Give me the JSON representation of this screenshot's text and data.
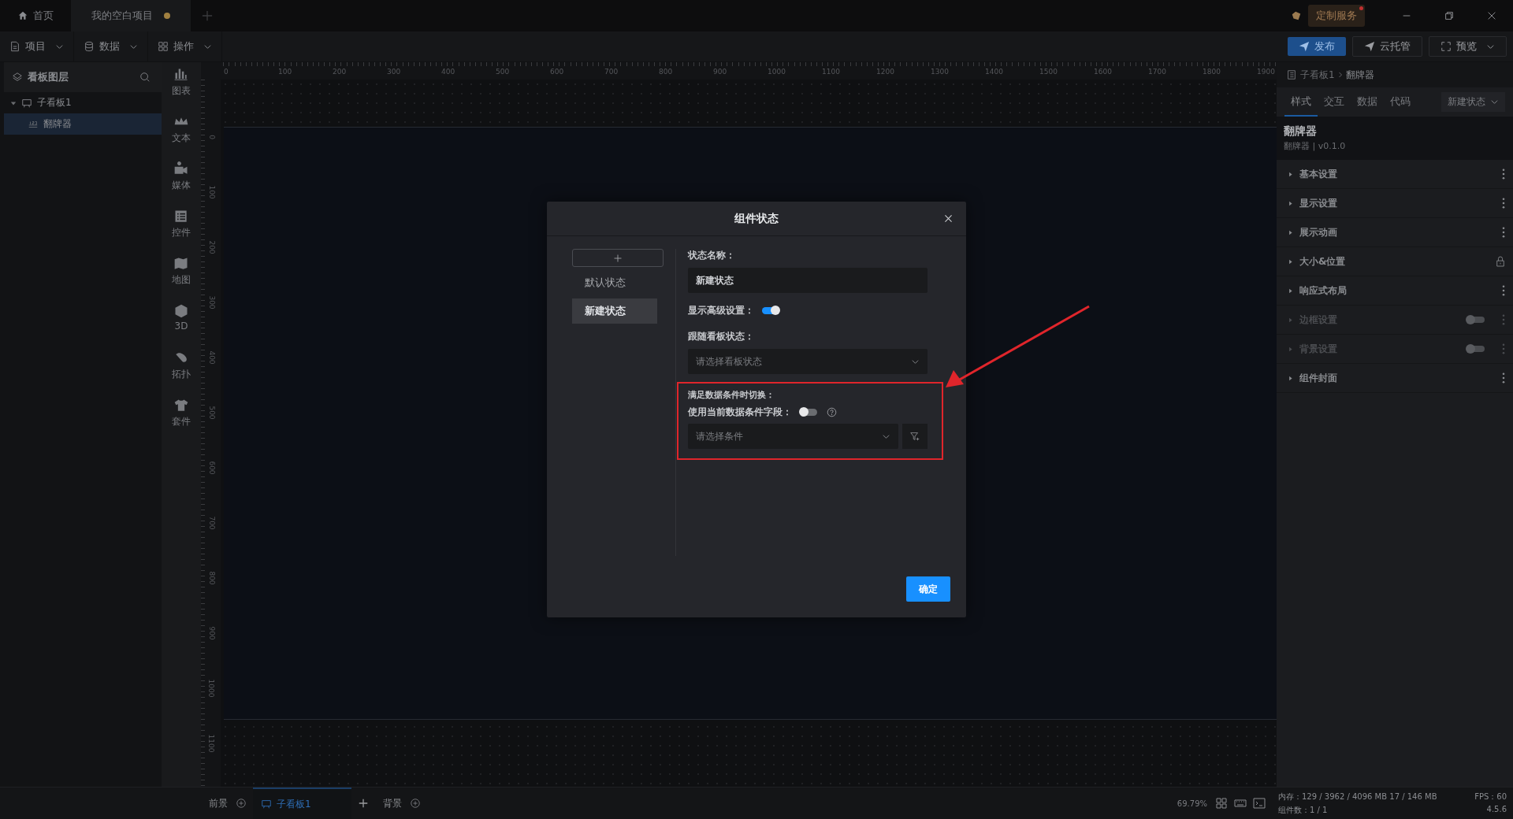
{
  "title_bar": {
    "tabs": [
      {
        "label": "首页",
        "kind": "home",
        "selected": false,
        "unsaved": false
      },
      {
        "label": "我的空白项目",
        "kind": "project",
        "selected": true,
        "unsaved": true
      }
    ],
    "service": "定制服务",
    "service_badge": true
  },
  "toolbar": {
    "menus": [
      "项目",
      "数据",
      "操作"
    ],
    "publish": "发布",
    "cloud": "云托管",
    "preview": "预览"
  },
  "layers": {
    "title": "看板图层",
    "tree": [
      {
        "label": "子看板1",
        "expanded": true,
        "selected": false,
        "children": [
          {
            "label": "翻牌器",
            "selected": true
          }
        ]
      }
    ]
  },
  "component_bar": [
    "图表",
    "文本",
    "媒体",
    "控件",
    "地图",
    "3D",
    "拓扑",
    "套件"
  ],
  "ruler": {
    "x_labels": [
      "0",
      "100",
      "200",
      "300",
      "400",
      "500",
      "600",
      "700",
      "800",
      "900",
      "1000",
      "1100",
      "1200",
      "1300",
      "1400",
      "1500",
      "1600",
      "1700",
      "1800",
      "1900"
    ],
    "y_labels": [
      "0",
      "100",
      "200",
      "300",
      "400",
      "500",
      "600",
      "700",
      "800",
      "900",
      "1000",
      "1100"
    ]
  },
  "dialog": {
    "title": "组件状态",
    "states": [
      {
        "label": "默认状态",
        "selected": false
      },
      {
        "label": "新建状态",
        "selected": true
      }
    ],
    "name_label": "状态名称：",
    "name_value": "新建状态",
    "advanced_label": "显示高级设置：",
    "advanced_on": true,
    "follow_label": "跟随看板状态：",
    "follow_placeholder": "请选择看板状态",
    "condition_title": "满足数据条件时切换：",
    "use_field_label": "使用当前数据条件字段：",
    "use_field_on": false,
    "condition_placeholder": "请选择条件",
    "confirm": "确定"
  },
  "inspector": {
    "breadcrumb": [
      "子看板1",
      "翻牌器"
    ],
    "tabs": [
      {
        "label": "样式",
        "selected": true
      },
      {
        "label": "交互",
        "selected": false
      },
      {
        "label": "数据",
        "selected": false
      },
      {
        "label": "代码",
        "selected": false
      }
    ],
    "state_select": "新建状态",
    "component_name": "翻牌器",
    "component_meta": "翻牌器 | v0.1.0",
    "sections": [
      {
        "label": "基本设置",
        "kind": "menu",
        "disabled": false
      },
      {
        "label": "显示设置",
        "kind": "menu",
        "disabled": false
      },
      {
        "label": "展示动画",
        "kind": "menu",
        "disabled": false
      },
      {
        "label": "大小&位置",
        "kind": "lock",
        "disabled": false
      },
      {
        "label": "响应式布局",
        "kind": "menu",
        "disabled": false
      },
      {
        "label": "边框设置",
        "kind": "toggle",
        "disabled": true,
        "on": false
      },
      {
        "label": "背景设置",
        "kind": "toggle",
        "disabled": true,
        "on": false
      },
      {
        "label": "组件封面",
        "kind": "menu",
        "disabled": false
      }
    ]
  },
  "bottom_bar": {
    "layers": [
      {
        "label": "前景",
        "selected": false,
        "addable": true
      },
      {
        "label": "子看板1",
        "selected": true,
        "addable": false
      },
      {
        "label": "背景",
        "selected": false,
        "addable": true
      }
    ],
    "zoom": "69.79%",
    "memory": "内存：129 / 3962 / 4096 MB 17 / 146 MB",
    "fps": "FPS：60",
    "count": "组件数：1 / 1",
    "version": "4.5.6"
  }
}
